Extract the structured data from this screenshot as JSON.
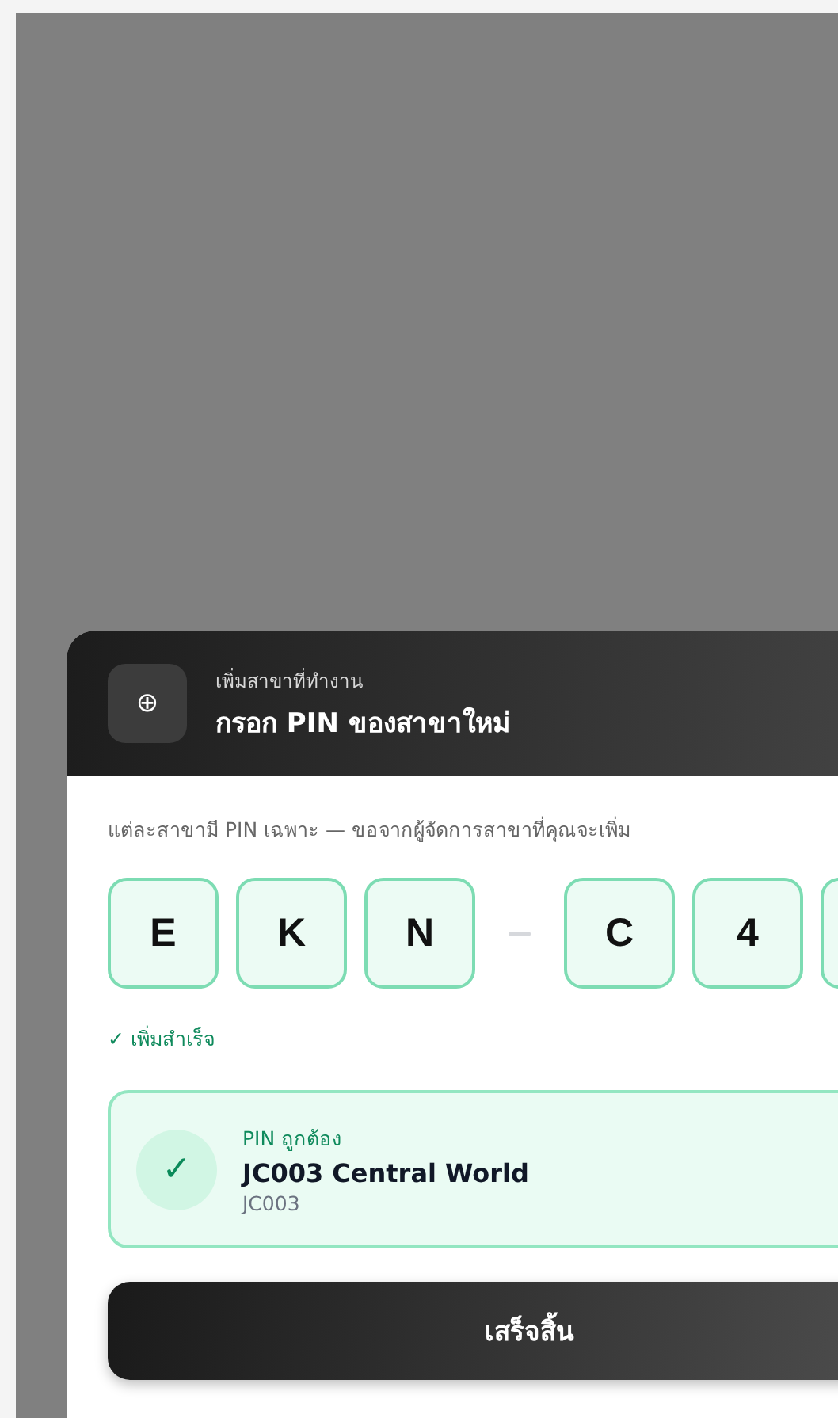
{
  "sheet": {
    "header": {
      "subtitle": "เพิ่มสาขาที่ทำงาน",
      "title": "กรอก PIN ของสาขาใหม่",
      "icon": "⊕"
    },
    "description": "แต่ละสาขามี PIN เฉพาะ — ขอจากผู้จัดการสาขาที่คุณจะเพิ่ม",
    "pin_cells": [
      {
        "kind": "char",
        "char": "E"
      },
      {
        "kind": "char",
        "char": "K"
      },
      {
        "kind": "char",
        "char": "N"
      },
      {
        "kind": "separator"
      },
      {
        "kind": "char",
        "char": "C"
      },
      {
        "kind": "char",
        "char": "4"
      },
      {
        "kind": "char_hidden"
      }
    ],
    "status": "✓ เพิ่มสำเร็จ",
    "result": {
      "check": "✓",
      "label": "PIN ถูกต้อง",
      "name": "JC003 Central World",
      "code": "JC003"
    },
    "button": "เสร็จสิ้น"
  }
}
